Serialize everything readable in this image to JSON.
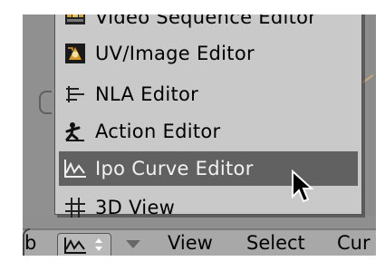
{
  "menu": {
    "items": [
      {
        "label": "Video Sequence Editor",
        "icon": "video-sequence-icon"
      },
      {
        "label": "UV/Image Editor",
        "icon": "uv-image-icon"
      },
      {
        "label": "NLA Editor",
        "icon": "nla-icon"
      },
      {
        "label": "Action Editor",
        "icon": "action-icon"
      },
      {
        "label": "Ipo Curve Editor",
        "icon": "ipo-curve-icon",
        "highlighted": true
      },
      {
        "label": "3D View",
        "icon": "3d-view-icon"
      }
    ]
  },
  "header": {
    "left_text": "b",
    "view_label": "View",
    "select_label": "Select",
    "curve_label": "Cur",
    "selector_icon": "ipo-curve-icon"
  },
  "colors": {
    "menu_bg": "#c9c9c9",
    "highlight_bg": "#616161",
    "highlight_text": "#f2f2f2",
    "header_bg": "#a8a8a8"
  }
}
